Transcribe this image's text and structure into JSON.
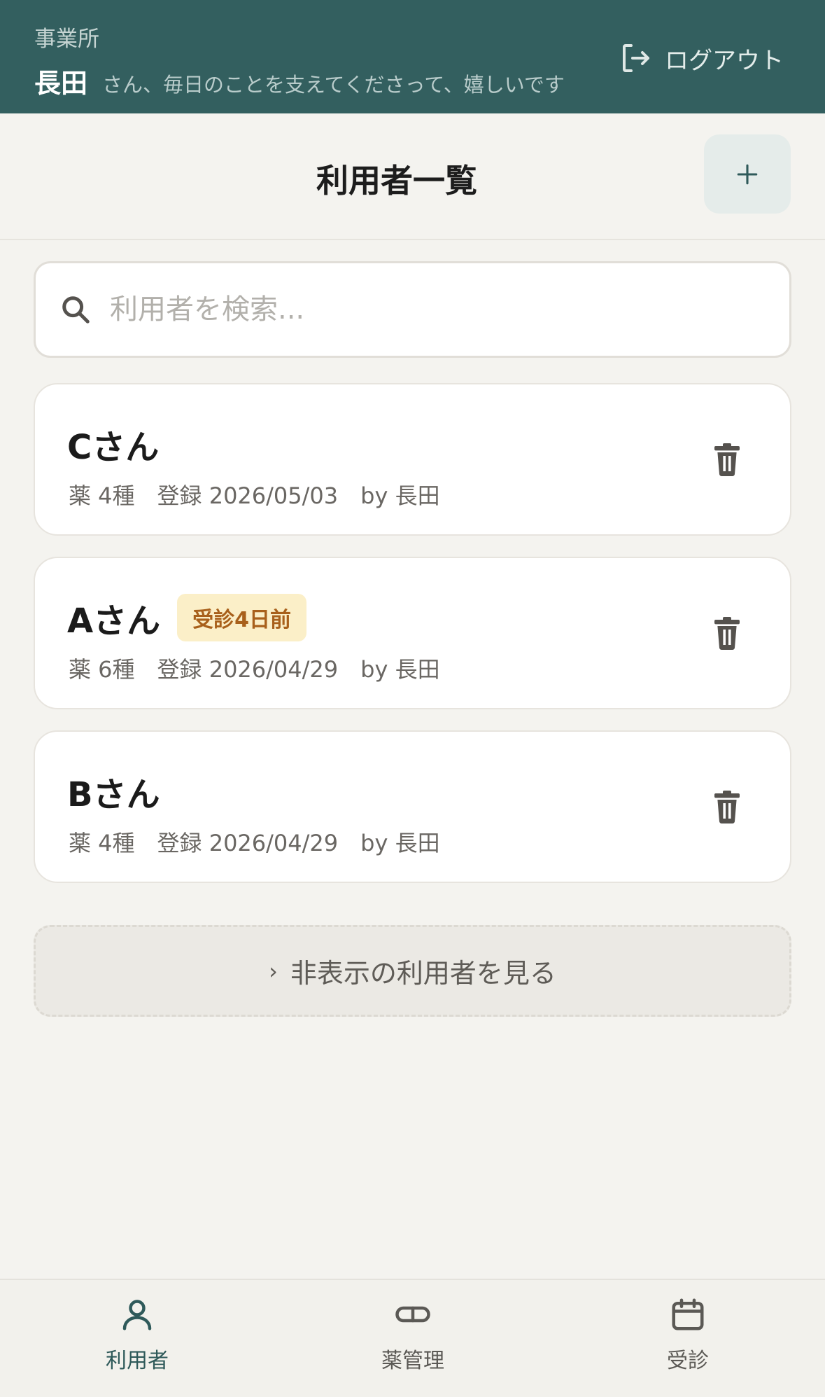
{
  "header": {
    "org_label": "事業所",
    "user_name": "長田",
    "greeting": "さん、毎日のことを支えてくださって、嬉しいです",
    "logout_label": "ログアウト",
    "logout_icon": "logout-icon"
  },
  "titlebar": {
    "title": "利用者一覧",
    "add_icon": "plus-icon"
  },
  "search": {
    "placeholder": "利用者を検索...",
    "value": "",
    "icon": "search-icon"
  },
  "users": [
    {
      "name": "Cさん",
      "badge": "",
      "meta": "薬 4種　登録 2026/05/03　by 長田"
    },
    {
      "name": "Aさん",
      "badge": "受診4日前",
      "meta": "薬 6種　登録 2026/04/29　by 長田"
    },
    {
      "name": "Bさん",
      "badge": "",
      "meta": "薬 4種　登録 2026/04/29　by 長田"
    }
  ],
  "hidden_users": {
    "chevron": "›",
    "label": "非表示の利用者を見る"
  },
  "bottom_nav": {
    "items": [
      {
        "label": "利用者",
        "icon": "person-icon",
        "active": true
      },
      {
        "label": "薬管理",
        "icon": "pill-icon",
        "active": false
      },
      {
        "label": "受診",
        "icon": "calendar-icon",
        "active": false
      }
    ]
  },
  "colors": {
    "header_bg": "#335f5f",
    "accent": "#2f5a5a",
    "badge_bg": "#fbefc8",
    "badge_text": "#a8601b",
    "page_bg": "#f4f3ef"
  }
}
